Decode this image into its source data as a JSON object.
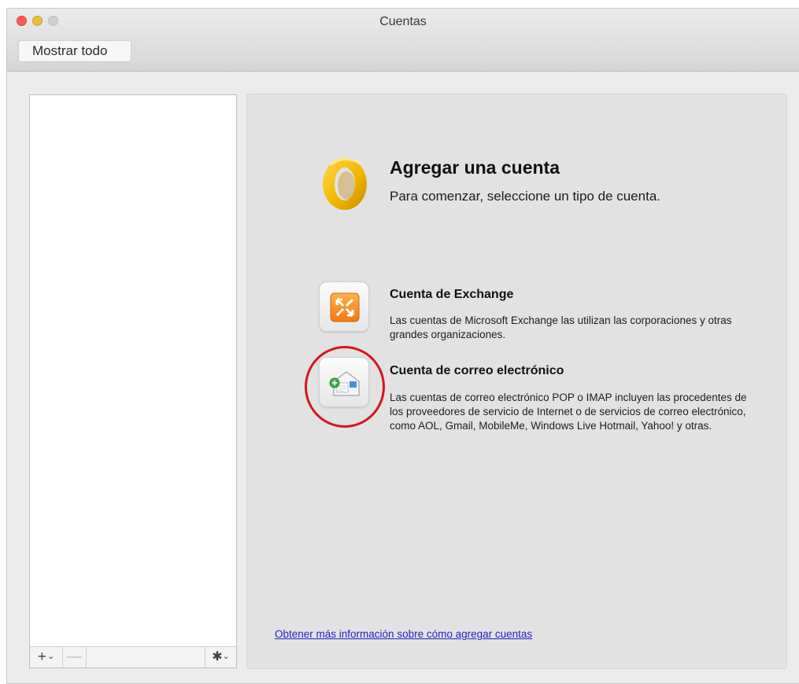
{
  "window": {
    "title": "Cuentas",
    "show_all_label": "Mostrar todo"
  },
  "sidebar": {
    "add_label": "+",
    "remove_label": "—",
    "gear_icon": "gear-icon",
    "chevron": "⌄"
  },
  "main": {
    "heading": "Agregar una cuenta",
    "subheading": "Para comenzar, seleccione un tipo de cuenta.",
    "options": [
      {
        "title": "Cuenta de Exchange",
        "description": "Las cuentas de Microsoft Exchange las utilizan las corporaciones y otras grandes organizaciones.",
        "icon": "exchange-icon"
      },
      {
        "title": "Cuenta de correo electrónico",
        "description": "Las cuentas de correo electrónico POP o IMAP incluyen las procedentes de los proveedores de servicio de Internet o de servicios de correo electrónico, como AOL, Gmail, MobileMe, Windows Live Hotmail, Yahoo! y otras.",
        "icon": "email-account-icon"
      }
    ],
    "help_link": "Obtener más información sobre cómo agregar cuentas"
  },
  "colors": {
    "highlight_circle": "#d4161b",
    "link": "#2222cc",
    "outlook_logo": "#f2b800"
  }
}
